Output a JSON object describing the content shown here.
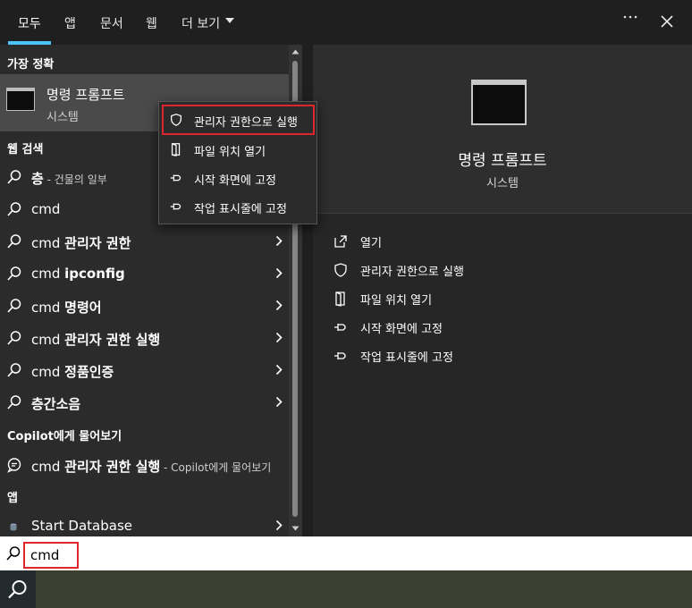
{
  "tabs": [
    {
      "label": "모두",
      "active": true
    },
    {
      "label": "앱"
    },
    {
      "label": "문서"
    },
    {
      "label": "웹"
    },
    {
      "label": "더 보기"
    }
  ],
  "top_icons": {
    "more": "more-options-icon",
    "close": "close-icon"
  },
  "left": {
    "best_match_header": "가장 정확",
    "best_match": {
      "title": "명령 프롬프트",
      "subtitle": "시스템",
      "icon": "command-prompt-icon"
    },
    "web_search_header": "웹 검색",
    "web_results": [
      {
        "bold": "층",
        "hint": " - 건물의 일부",
        "chevron": false
      },
      {
        "text": "cmd",
        "chevron": false
      },
      {
        "text": "cmd ",
        "bold": "관리자 권한",
        "chevron": true
      },
      {
        "text": "cmd ",
        "bold": "ipconfig",
        "chevron": true
      },
      {
        "text": "cmd ",
        "bold": "명령어",
        "chevron": true
      },
      {
        "text": "cmd ",
        "bold": "관리자 권한 실행",
        "chevron": true
      },
      {
        "text": "cmd ",
        "bold": "정품인증",
        "chevron": true
      },
      {
        "bold": "층간소음",
        "chevron": true
      }
    ],
    "copilot_header": "Copilot에게 물어보기",
    "copilot_result": {
      "text": "cmd ",
      "bold": "관리자 권한 실행",
      "hint": " - Copilot에게 물어보기"
    },
    "apps_header": "앱",
    "app_result": {
      "text": "Start Database",
      "chevron": true
    }
  },
  "context_menu": [
    {
      "label": "관리자 권한으로 실행",
      "icon": "shield-icon"
    },
    {
      "label": "파일 위치 열기",
      "icon": "folder-icon"
    },
    {
      "label": "시작 화면에 고정",
      "icon": "pin-icon"
    },
    {
      "label": "작업 표시줄에 고정",
      "icon": "pin-icon"
    }
  ],
  "right": {
    "title": "명령 프롬프트",
    "subtitle": "시스템",
    "actions": [
      {
        "label": "열기",
        "icon": "open-icon"
      },
      {
        "label": "관리자 권한으로 실행",
        "icon": "shield-icon"
      },
      {
        "label": "파일 위치 열기",
        "icon": "folder-icon"
      },
      {
        "label": "시작 화면에 고정",
        "icon": "pin-icon"
      },
      {
        "label": "작업 표시줄에 고정",
        "icon": "pin-icon"
      }
    ]
  },
  "search": {
    "value": "cmd",
    "icon": "search-icon"
  },
  "colors": {
    "accent": "#4cc2ff",
    "highlight_border": "#e0262d"
  }
}
